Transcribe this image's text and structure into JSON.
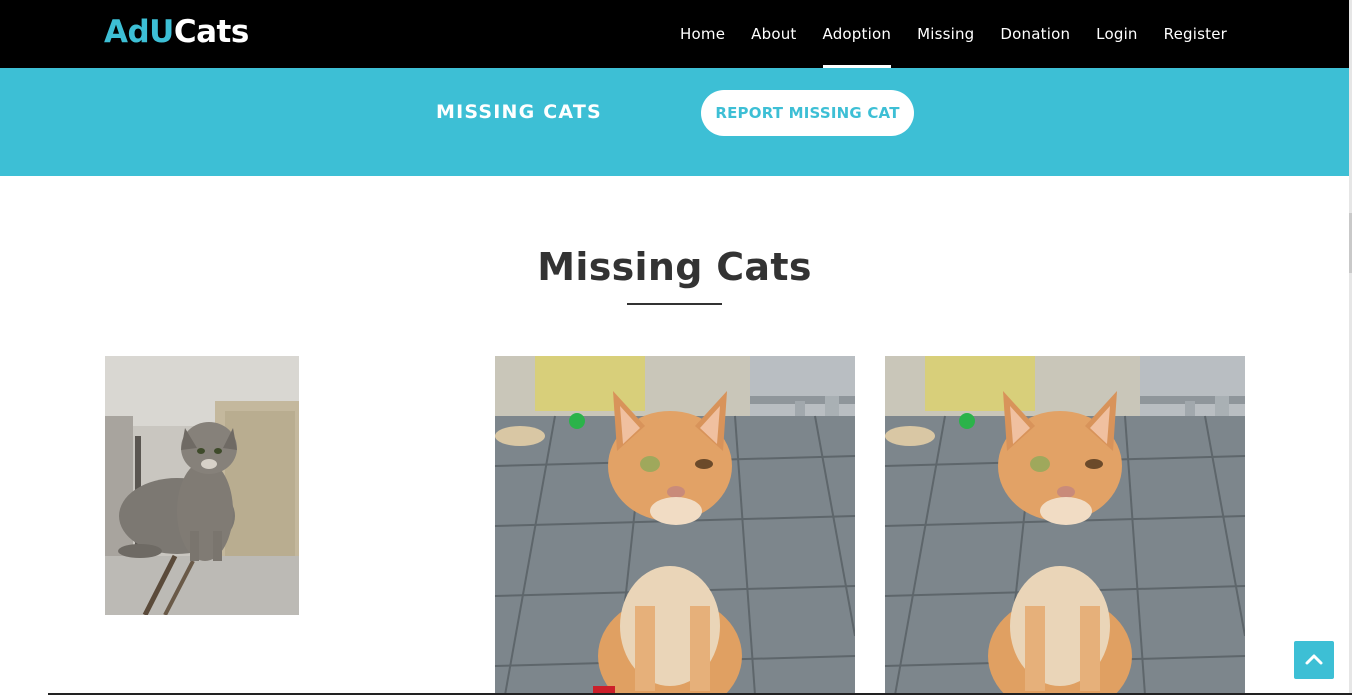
{
  "brand": {
    "part1": "AdU",
    "part2": "Cats"
  },
  "nav": {
    "items": [
      {
        "label": "Home"
      },
      {
        "label": "About"
      },
      {
        "label": "Adoption",
        "active": true
      },
      {
        "label": "Missing"
      },
      {
        "label": "Donation"
      },
      {
        "label": "Login"
      },
      {
        "label": "Register"
      }
    ]
  },
  "band": {
    "title": "MISSING CATS",
    "report_button": "REPORT MISSING CAT"
  },
  "main": {
    "title": "Missing Cats",
    "cats": [
      {
        "photo": "tabby-kitten-photo"
      },
      {
        "photo": "orange-cat-photo"
      },
      {
        "photo": "orange-cat-photo"
      }
    ]
  },
  "colors": {
    "accent": "#3dbfd5",
    "navbar": "#000000",
    "heading": "#333333"
  },
  "icons": {
    "back_to_top": "chevron-up-icon"
  }
}
